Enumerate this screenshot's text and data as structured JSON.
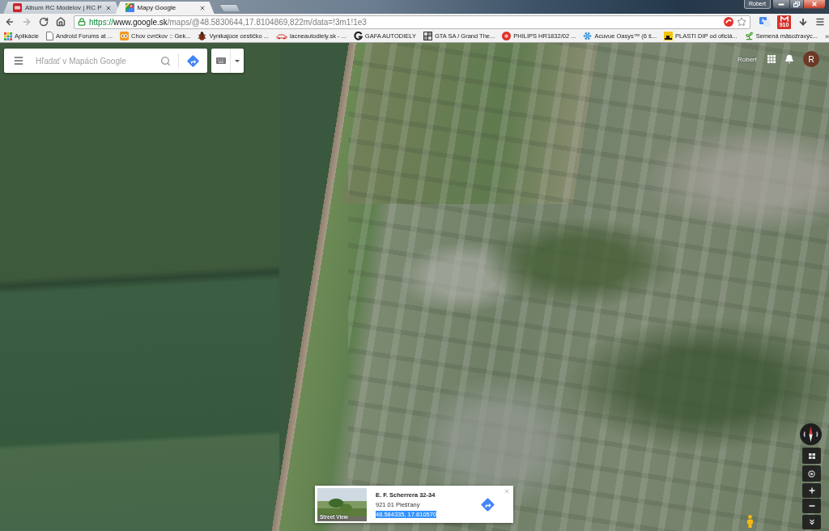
{
  "browser": {
    "tabs": [
      {
        "title": "Album RC Modelov | RC P",
        "selected": false
      },
      {
        "title": "Mapy Google",
        "selected": true
      }
    ],
    "profile_name": "Robert",
    "forward_disabled": true,
    "address": [
      {
        "kind": "scheme",
        "text": "https://"
      },
      {
        "kind": "host",
        "text": "www.google.sk"
      },
      {
        "kind": "path",
        "text": "/maps/@48.5830644,17.8104869,822m/data=!3m1!1e3"
      }
    ],
    "mail_badge": "910",
    "bookmarks": [
      {
        "label": "Aplikácie"
      },
      {
        "label": "Android Forums at ..."
      },
      {
        "label": "Chov cvrčkov :: Gek..."
      },
      {
        "label": "Vynikajúce cestičko ..."
      },
      {
        "label": "lacneautodiely.sk - ..."
      },
      {
        "label": "GAFA AUTODIELY"
      },
      {
        "label": "GTA SA / Grand The..."
      },
      {
        "label": "PHILIPS HR1832/02 ..."
      },
      {
        "label": "Acuvue Oasys™ (6 š..."
      },
      {
        "label": "PLASTI DIP od oficiá..."
      },
      {
        "label": "Semená mäsožravýc..."
      }
    ],
    "bookmarks_overflow": "»"
  },
  "maps": {
    "search": {
      "placeholder": "Hľadať v Mapách Google"
    },
    "account": {
      "name": "Robert",
      "initial": "R"
    },
    "place_card": {
      "thumbnail_label": "Street View",
      "title": "E. F. Scherrera 32-34",
      "address": "921 01 Piešťany",
      "coordinates": "48.584335, 17.810570",
      "coordinates_selected": true
    }
  }
}
